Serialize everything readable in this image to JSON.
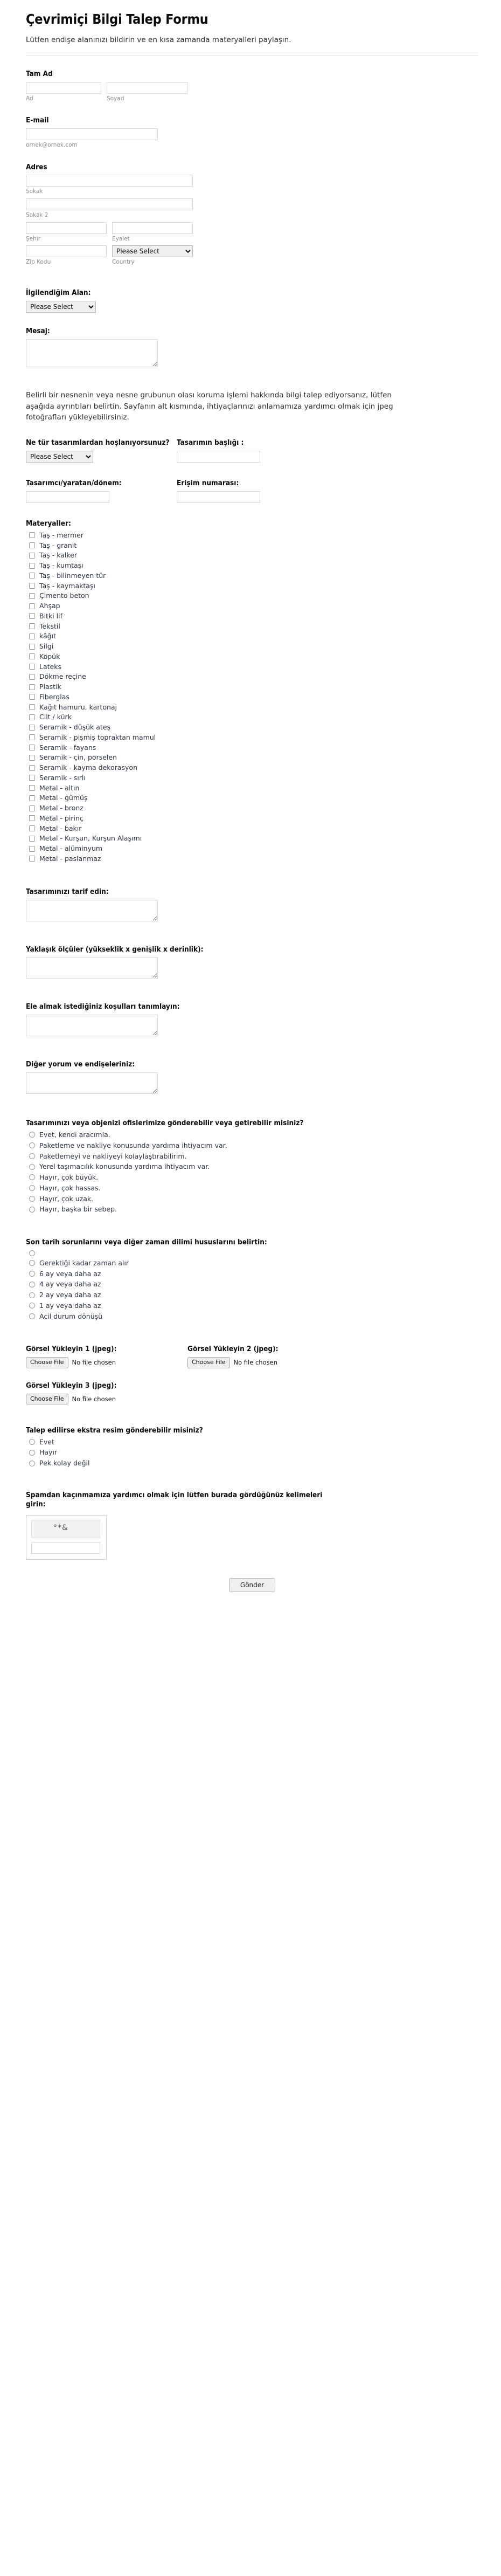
{
  "header": {
    "title": "Çevrimiçi Bilgi Talep Formu",
    "subtitle": "Lütfen endişe alanınızı bildirin ve en kısa zamanda materyalleri paylaşın."
  },
  "full_name": {
    "label": "Tam Ad",
    "first_value": "",
    "first_sublabel": "Ad",
    "last_value": "",
    "last_sublabel": "Soyad"
  },
  "email": {
    "label": "E-mail",
    "value": "",
    "sublabel": "ornek@ornek.com"
  },
  "address": {
    "label": "Adres",
    "street1_value": "",
    "street1_sublabel": "Sokak",
    "street2_value": "",
    "street2_sublabel": "Sokak 2",
    "city_value": "",
    "city_sublabel": "Şehir",
    "state_value": "",
    "state_sublabel": "Eyalet",
    "zip_value": "",
    "zip_sublabel": "Zip Kodu",
    "country_value": "Please Select",
    "country_sublabel": "Country"
  },
  "interest": {
    "label": "İlgilendiğim Alan:",
    "value": "Please Select"
  },
  "message": {
    "label": "Mesaj:",
    "value": ""
  },
  "intro_paragraph": "Belirli bir nesnenin veya nesne grubunun olası koruma işlemi hakkında bilgi talep ediyorsanız, lütfen aşağıda ayrıntıları belirtin. Sayfanın alt kısmında, ihtiyaçlarınızı anlamamıza yardımcı olmak için jpeg fotoğrafları yükleyebilirsiniz.",
  "design_type": {
    "label": "Ne tür tasarımlardan hoşlanıyorsunuz?",
    "value": "Please Select"
  },
  "design_title": {
    "label": "Tasarımın başlığı :",
    "value": ""
  },
  "designer": {
    "label": "Tasarımcı/yaratan/dönem:",
    "value": ""
  },
  "accession": {
    "label": "Erişim numarası:",
    "value": ""
  },
  "materials": {
    "label": "Materyaller:",
    "options": [
      "Taş - mermer",
      "Taş - granit",
      "Taş - kalker",
      "Taş - kumtaşı",
      "Taş - bilinmeyen tür",
      "Taş - kaymaktaşı",
      "Çimento beton",
      "Ahşap",
      "Bitki lif",
      "Tekstil",
      "kâğıt",
      "Silgi",
      "Köpük",
      "Lateks",
      "Dökme reçine",
      "Plastik",
      "Fiberglas",
      "Kağıt hamuru, kartonaj",
      "Cilt / kürk",
      "Seramik - düşük ateş",
      "Seramik - pişmiş topraktan mamul",
      "Seramik - fayans",
      "Seramik - çin, porselen",
      "Seramik - kayma dekorasyon",
      "Seramik - sırlı",
      "Metal - altın",
      "Metal - gümüş",
      "Metal - bronz",
      "Metal - pirinç",
      "Metal - bakır",
      "Metal - Kurşun, Kurşun Alaşımı",
      "Metal - alüminyum",
      "Metal - paslanmaz"
    ]
  },
  "describe_design": {
    "label": "Tasarımınızı tarif edin:",
    "value": ""
  },
  "dimensions": {
    "label": "Yaklaşık ölçüler (yükseklik x genişlik x derinlik):",
    "value": ""
  },
  "conditions": {
    "label": "Ele almak istediğiniz koşulları tanımlayın:",
    "value": ""
  },
  "other_comments": {
    "label": "Diğer yorum ve endişeleriniz:",
    "value": ""
  },
  "shipping": {
    "label": "Tasarımınızı veya objenizi ofislerimize gönderebilir veya getirebilir misiniz?",
    "options": [
      "Evet, kendi aracımla.",
      "Paketleme ve nakliye konusunda yardıma ihtiyacım var.",
      "Paketlemeyi ve nakliyeyi kolaylaştırabilirim.",
      "Yerel taşımacılık konusunda yardıma ihtiyacım var.",
      "Hayır, çok büyük.",
      "Hayır, çok hassas.",
      "Hayır, çok uzak.",
      "Hayır, başka bir sebep."
    ]
  },
  "deadline": {
    "label": "Son tarih sorunlarını veya diğer zaman dilimi hususlarını belirtin:",
    "options": [
      "",
      "Gerektiği kadar zaman alır",
      "6 ay veya daha az",
      "4 ay veya daha az",
      "2 ay veya daha az",
      "1 ay veya daha az",
      "Acil durum dönüşü"
    ]
  },
  "uploads": {
    "image1_label": "Görsel Yükleyin 1 (jpeg):",
    "image2_label": "Görsel Yükleyin 2 (jpeg):",
    "image3_label": "Görsel Yükleyin 3 (jpeg):",
    "button_text": "Choose File",
    "status_text": "No file chosen"
  },
  "extra_images": {
    "label": "Talep edilirse ekstra resim gönderebilir misiniz?",
    "options": [
      "Evet",
      "Hayır",
      "Pek kolay değil"
    ]
  },
  "captcha": {
    "label": "Spamdan kaçınmamıza yardımcı olmak için lütfen burada gördüğünüz kelimeleri girin:",
    "image_text": "°*&",
    "input_value": ""
  },
  "submit": {
    "label": "Gönder"
  }
}
